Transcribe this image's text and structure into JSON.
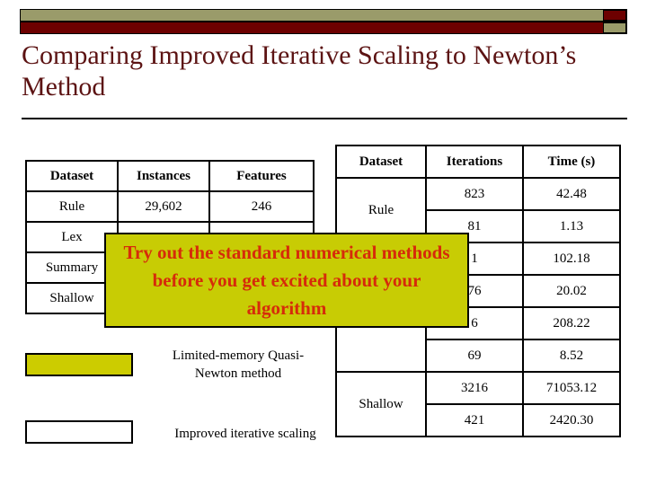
{
  "slide": {
    "title": "Comparing Improved Iterative Scaling to Newton’s Method"
  },
  "theme": {
    "bar_khaki": "#9a9b6a",
    "bar_maroon": "#6d0000",
    "title_color": "#5c1313",
    "callout_bg": "#c8cc04",
    "callout_text_color": "#d62b0a",
    "table_highlight": "#cccc00"
  },
  "left_table": {
    "headers": [
      "Dataset",
      "Instances",
      "Features"
    ],
    "rows": [
      [
        "Rule",
        "29,602",
        "246"
      ],
      [
        "Lex",
        "",
        ""
      ],
      [
        "Summary",
        "",
        ""
      ],
      [
        "Shallow",
        "",
        ""
      ]
    ]
  },
  "right_table": {
    "headers": [
      "Dataset",
      "Iterations",
      "Time (s)"
    ],
    "groups": [
      {
        "dataset": "Rule",
        "rows": [
          {
            "iterations": "823",
            "time": "42.48",
            "highlight": false
          },
          {
            "iterations": "81",
            "time": "1.13",
            "highlight": true
          }
        ]
      },
      {
        "dataset": "",
        "rows": [
          {
            "iterations": "1",
            "time": "102.18",
            "highlight": false
          },
          {
            "iterations": "76",
            "time": "20.02",
            "highlight": true
          }
        ]
      },
      {
        "dataset": "",
        "rows": [
          {
            "iterations": "6",
            "time": "208.22",
            "highlight": false
          },
          {
            "iterations": "69",
            "time": "8.52",
            "highlight": true
          }
        ]
      },
      {
        "dataset": "Shallow",
        "rows": [
          {
            "iterations": "3216",
            "time": "71053.12",
            "highlight": false
          },
          {
            "iterations": "421",
            "time": "2420.30",
            "highlight": true
          }
        ]
      }
    ]
  },
  "callout": {
    "text": "Try out the standard numerical methods before you get excited about your algorithm"
  },
  "legend": {
    "items": [
      {
        "label": "Limited-memory Quasi-Newton method",
        "color": "#cccc00"
      },
      {
        "label": "Improved iterative scaling",
        "color": "#ffffff"
      }
    ]
  }
}
